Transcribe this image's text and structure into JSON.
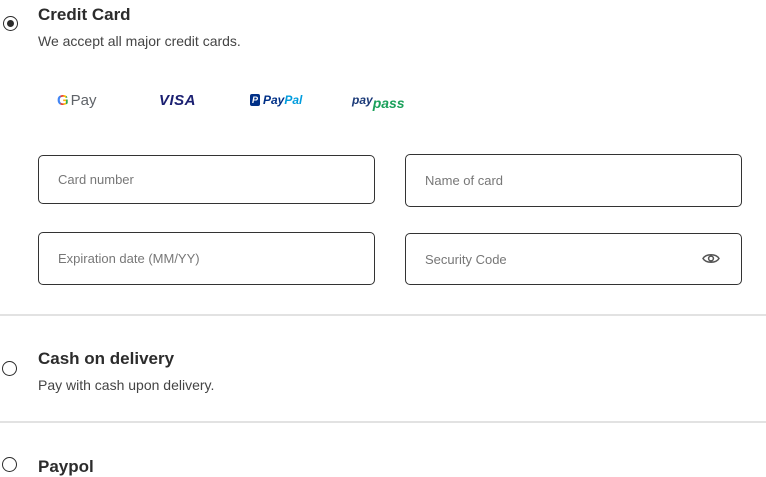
{
  "credit_card": {
    "title": "Credit Card",
    "description": "We accept all major credit cards.",
    "selected": true,
    "logos": {
      "gpay": {
        "g": "G",
        "text": "Pay"
      },
      "visa": "VISA",
      "paypal": {
        "mark": "P",
        "part1": "Pay",
        "part2": "Pal"
      },
      "paypass": {
        "part1": "pay",
        "part2": "pass"
      }
    },
    "fields": {
      "card_number": {
        "placeholder": "Card number",
        "value": ""
      },
      "name_of_card": {
        "placeholder": "Name of card",
        "value": ""
      },
      "expiration": {
        "placeholder": "Expiration date (MM/YY)",
        "value": ""
      },
      "security_code": {
        "placeholder": "Security Code",
        "value": ""
      }
    }
  },
  "cash_on_delivery": {
    "title": "Cash on delivery",
    "description": "Pay with cash upon delivery.",
    "selected": false
  },
  "paypal_option": {
    "title": "Paypol",
    "selected": false
  },
  "colors": {
    "border": "#333333",
    "divider": "#e2e2e2",
    "text": "#2c2c2c"
  }
}
